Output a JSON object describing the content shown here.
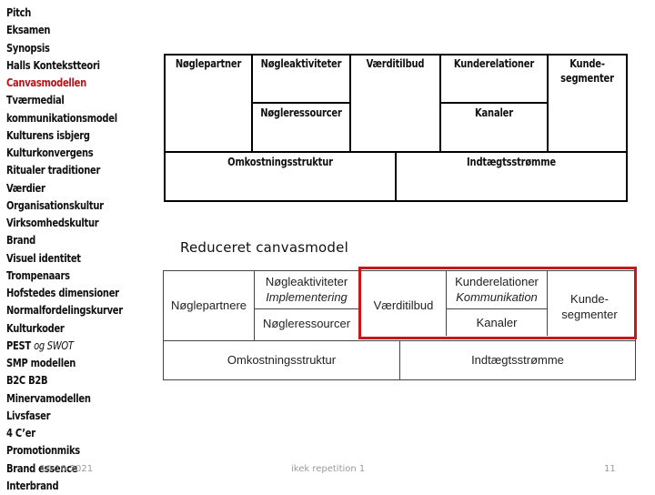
{
  "sidebar": {
    "items": [
      {
        "label": "Pitch"
      },
      {
        "label": "Eksamen"
      },
      {
        "label": "Synopsis"
      },
      {
        "label": "Halls Kontekstteori"
      },
      {
        "label": "Canvasmodellen",
        "active": true
      },
      {
        "label": "Tværmedial"
      },
      {
        "label": "kommunikationsmodel"
      },
      {
        "label": "Kulturens isbjerg"
      },
      {
        "label": "Kulturkonvergens"
      },
      {
        "label": "Ritualer traditioner"
      },
      {
        "label": "Værdier"
      },
      {
        "label": "Organisationskultur"
      },
      {
        "label": "Virksomhedskultur"
      },
      {
        "label": "Brand"
      },
      {
        "label": "Visuel identitet"
      },
      {
        "label": "Trompenaars"
      },
      {
        "label": "Hofstedes dimensioner"
      },
      {
        "label": "Normalfordelingskurver"
      },
      {
        "label": "Kulturkoder"
      },
      {
        "label": "PEST",
        "suffix_italic": "og SWOT"
      },
      {
        "label": "SMP modellen"
      },
      {
        "label": "B2C B2B"
      },
      {
        "label": "Minervamodellen"
      },
      {
        "label": "Livsfaser"
      },
      {
        "label": "4 C’er"
      },
      {
        "label": "Promotionmiks"
      },
      {
        "label": "Brand essence"
      },
      {
        "label": "Interbrand"
      }
    ]
  },
  "canvas": {
    "key_partners": "Nøglepartner",
    "key_activities": "Nøgleaktiviteter",
    "value_proposition": "Værditilbud",
    "customer_relations": "Kunderelationer",
    "customer_segments_1": "Kunde-",
    "customer_segments_2": "segmenter",
    "key_resources": "Nøgleressourcer",
    "channels": "Kanaler",
    "cost_structure": "Omkostningsstruktur",
    "revenue_streams": "Indtægtsstrømme"
  },
  "reduced": {
    "title": "Reduceret canvasmodel",
    "key_partners": "Nøglepartnere",
    "key_activities": "Nøgleaktiviteter",
    "key_activities_sub": "Implementering",
    "key_resources": "Nøgleressourcer",
    "value_proposition": "Værditilbud",
    "customer_relations": "Kunderelationer",
    "customer_relations_sub": "Kommunikation",
    "channels": "Kanaler",
    "customer_segments_1": "Kunde-",
    "customer_segments_2": "segmenter",
    "cost_structure": "Omkostningsstruktur",
    "revenue_streams": "Indtægtsstrømme",
    "highlight_color": "#c8161d"
  },
  "footer": {
    "date": "10-10-2021",
    "title": "ikek repetition 1",
    "page_number": "11"
  }
}
